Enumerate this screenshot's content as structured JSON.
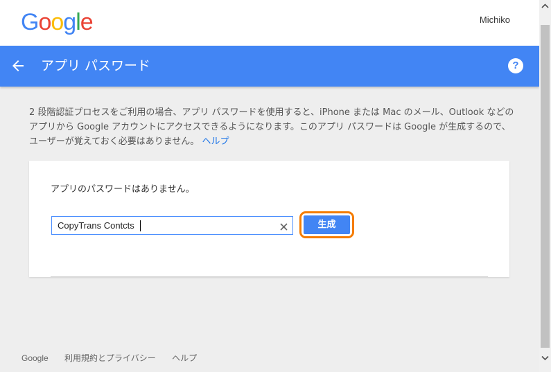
{
  "header": {
    "logo_letters": [
      {
        "ch": "G",
        "color": "#4285F4"
      },
      {
        "ch": "o",
        "color": "#EA4335"
      },
      {
        "ch": "o",
        "color": "#FBBC05"
      },
      {
        "ch": "g",
        "color": "#4285F4"
      },
      {
        "ch": "l",
        "color": "#34A853"
      },
      {
        "ch": "e",
        "color": "#EA4335"
      }
    ],
    "username": "Michiko"
  },
  "titlebar": {
    "title": "アプリ パスワード",
    "back_icon": "arrow-left-icon",
    "help_icon": "help-icon",
    "help_glyph": "?"
  },
  "description": {
    "text": "2 段階認証プロセスをご利用の場合、アプリ パスワードを使用すると、iPhone または Mac のメール、Outlook などのアプリから Google アカウントにアクセスできるようになります。このアプリ パスワードは Google が生成するので、ユーザーが覚えておく必要はありません。",
    "help_link": "ヘルプ"
  },
  "card": {
    "no_passwords": "アプリのパスワードはありません。",
    "app_name_value": "CopyTrans Contcts",
    "generate_label": "生成"
  },
  "footer": {
    "links": [
      "Google",
      "利用規約とプライバシー",
      "ヘルプ"
    ]
  },
  "colors": {
    "brand_blue": "#4285f4",
    "highlight_orange": "#f57c00",
    "background": "#eeeeee"
  }
}
